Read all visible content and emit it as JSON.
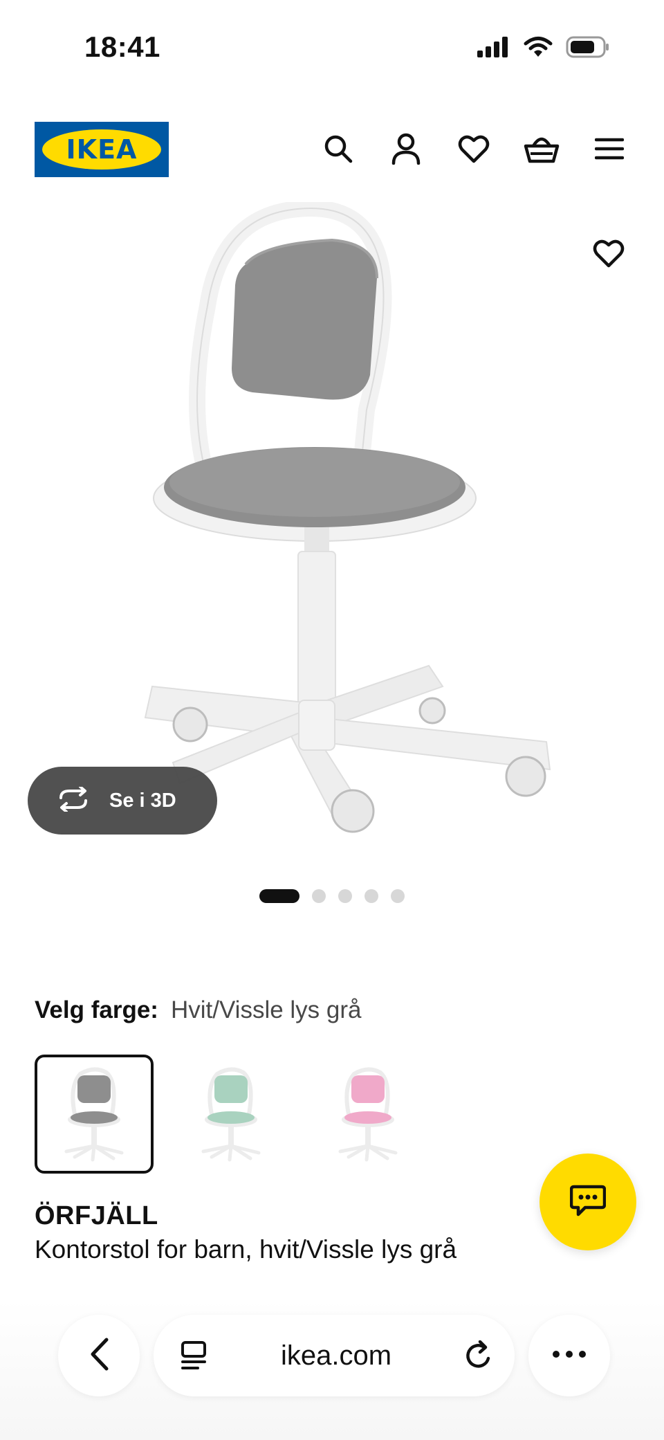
{
  "status_bar": {
    "time": "18:41",
    "icons": [
      "signal-icon",
      "wifi-icon",
      "battery-icon"
    ]
  },
  "header": {
    "logo_text": "IKEA",
    "nav_icons": [
      "search-icon",
      "account-icon",
      "favorites-icon",
      "basket-icon",
      "menu-icon"
    ]
  },
  "media": {
    "view_3d_label": "Se i 3D",
    "image_count": 5,
    "active_image_index": 0
  },
  "color_picker": {
    "label": "Velg farge:",
    "selected_value": "Hvit/Vissle lys grå",
    "options": [
      {
        "seat_color": "#8e8e8e",
        "selected": true
      },
      {
        "seat_color": "#a9d2bf",
        "selected": false
      },
      {
        "seat_color": "#f0a9c9",
        "selected": false
      }
    ]
  },
  "product": {
    "name": "ÖRFJÄLL",
    "description": "Kontorstol for barn, hvit/Vissle lys grå"
  },
  "browser": {
    "url": "ikea.com"
  },
  "colors": {
    "ikea_blue": "#0058a3",
    "ikea_yellow": "#ffdb00",
    "seat_gray": "#8e8e8e",
    "frame_white": "#f2f2f2"
  }
}
